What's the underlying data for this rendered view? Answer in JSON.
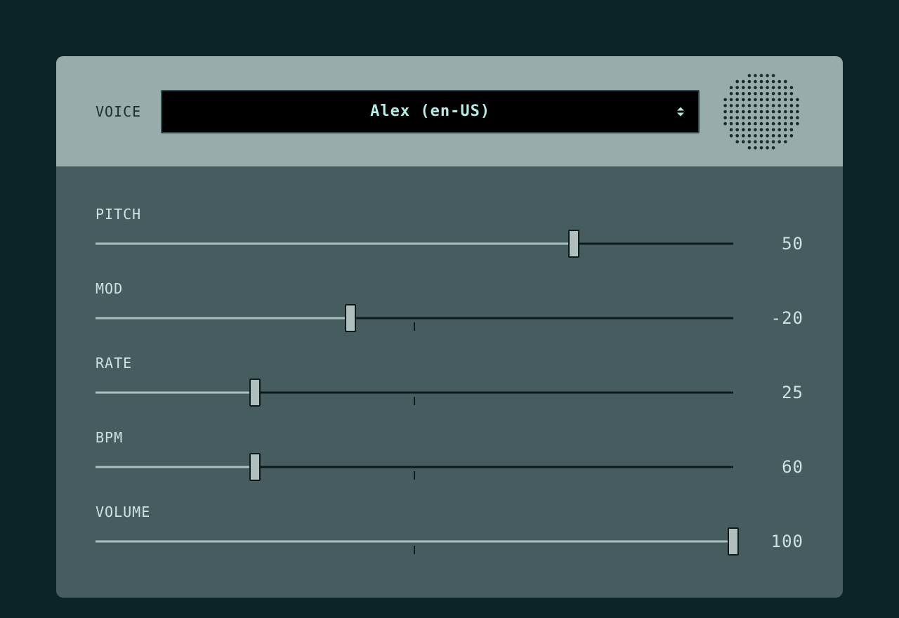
{
  "header": {
    "voice_label": "VOICE",
    "voice_selected": "Alex (en-US)"
  },
  "sliders": [
    {
      "id": "pitch",
      "label": "PITCH",
      "value": 50,
      "display": "50",
      "min": -100,
      "max": 100,
      "show_center_tick": false
    },
    {
      "id": "mod",
      "label": "MOD",
      "value": -20,
      "display": "-20",
      "min": -100,
      "max": 100,
      "show_center_tick": true
    },
    {
      "id": "rate",
      "label": "RATE",
      "value": 25,
      "display": "25",
      "min": 0,
      "max": 100,
      "show_center_tick": true
    },
    {
      "id": "bpm",
      "label": "BPM",
      "value": 60,
      "display": "60",
      "min": 0,
      "max": 240,
      "show_center_tick": true
    },
    {
      "id": "volume",
      "label": "VOLUME",
      "value": 100,
      "display": "100",
      "min": 0,
      "max": 100,
      "show_center_tick": true
    }
  ],
  "colors": {
    "page_bg": "#0c2427",
    "panel_body": "#465c5e",
    "panel_header": "#97acab",
    "select_bg": "#000000",
    "select_fg": "#b7ece6",
    "track_dark": "#0e1b1c",
    "track_light": "#aebfbe",
    "text_light": "#cfe2e0"
  }
}
